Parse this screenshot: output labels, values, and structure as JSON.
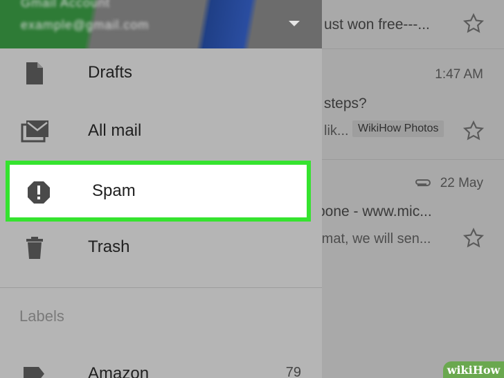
{
  "header": {
    "account_name": "Gmail Account",
    "account_email": "example@gmail.com",
    "switch_icon": "caret-down-icon"
  },
  "drawer": {
    "items": [
      {
        "label": "Drafts",
        "icon": "draft-icon"
      },
      {
        "label": "All mail",
        "icon": "all-mail-icon"
      },
      {
        "label": "Spam",
        "icon": "spam-icon",
        "active": true
      },
      {
        "label": "Trash",
        "icon": "trash-icon"
      }
    ],
    "labels_section": "Labels",
    "label_items": [
      {
        "label": "Amazon",
        "count": "79",
        "icon": "tag-icon"
      }
    ]
  },
  "inbox": {
    "rows": [
      {
        "snippet": "ust won free---..."
      },
      {
        "time": "1:47 AM",
        "subject": "' steps?",
        "preview": "lik...",
        "chip": "WikiHow Photos"
      },
      {
        "time": "22 May",
        "subject": "pone - www.mic...",
        "preview": "rmat, we will sen..."
      }
    ]
  },
  "watermark": "wikiHow",
  "colors": {
    "highlight": "#35e32f",
    "drawer_bg": "#b5b5b5",
    "header_green": "#2e7b36",
    "header_blue": "#2a4da0"
  }
}
